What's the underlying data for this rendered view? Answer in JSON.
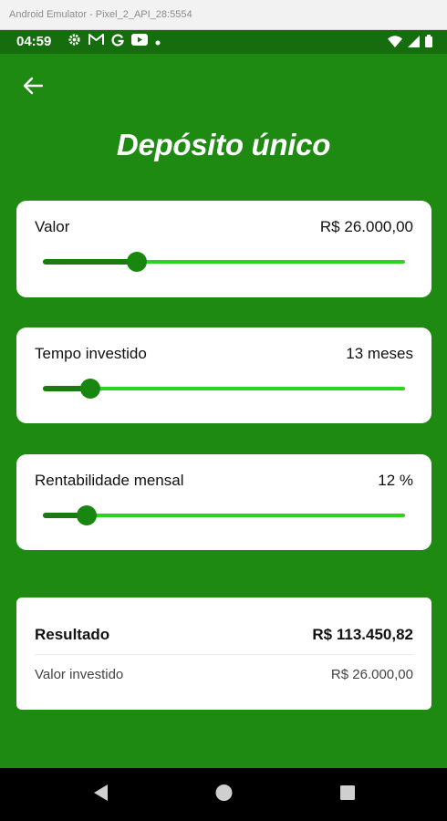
{
  "window": {
    "title": "Android Emulator - Pixel_2_API_28:5554"
  },
  "status_bar": {
    "time": "04:59",
    "left_icons": [
      "gear-icon",
      "gmail-icon",
      "google-icon",
      "youtube-icon",
      "dot-icon"
    ],
    "right_icons": [
      "wifi-icon",
      "signal-icon",
      "battery-icon"
    ]
  },
  "header": {
    "title": "Depósito único",
    "back_icon": "arrow-left-icon"
  },
  "sliders": [
    {
      "label": "Valor",
      "value": "R$ 26.000,00",
      "fraction": 0.26
    },
    {
      "label": "Tempo investido",
      "value": "13 meses",
      "fraction": 0.13
    },
    {
      "label": "Rentabilidade mensal",
      "value": "12 %",
      "fraction": 0.12
    }
  ],
  "result": {
    "label": "Resultado",
    "value": "R$ 113.450,82",
    "invested_label": "Valor investido",
    "invested_value": "R$ 26.000,00"
  },
  "nav_bar": {
    "icons": [
      "back-triangle-icon",
      "home-circle-icon",
      "recents-square-icon"
    ]
  },
  "colors": {
    "background": "#1e8a12",
    "status_bar": "#166d0d",
    "slider_track": "#2ad421",
    "slider_active": "#1b7a10",
    "slider_thumb": "#19870f"
  }
}
